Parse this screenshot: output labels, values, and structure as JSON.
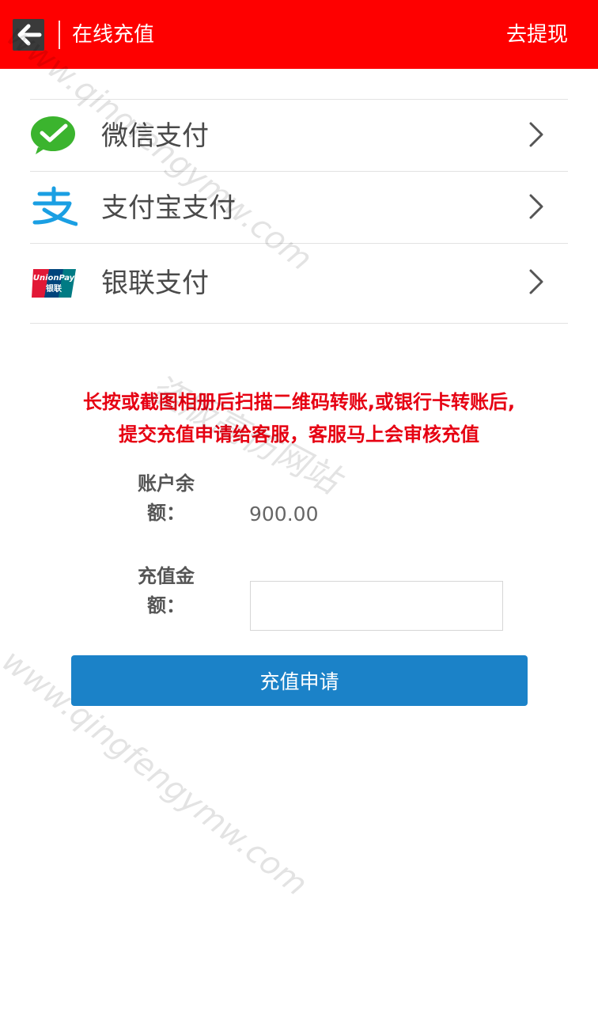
{
  "header": {
    "title": "在线充值",
    "action_label": "去提现",
    "background": "#fe0000",
    "back_icon": "arrow-left-icon"
  },
  "payment_methods": [
    {
      "label": "微信支付",
      "icon": "wechat-pay-icon",
      "chevron": "chevron-right-icon"
    },
    {
      "label": "支付宝支付",
      "icon": "alipay-icon",
      "chevron": "chevron-right-icon"
    },
    {
      "label": "银联支付",
      "icon": "unionpay-icon",
      "icon_text": "UnionPay",
      "icon_subtext": "银联",
      "chevron": "chevron-right-icon"
    }
  ],
  "notice": {
    "line1": "长按或截图相册后扫描二维码转账,或银行卡转账后,",
    "line2": "提交充值申请给客服，客服马上会审核充值",
    "color": "#e60012"
  },
  "balance": {
    "label_line1": "账户余",
    "label_line2": "额：",
    "value": "900.00"
  },
  "amount": {
    "label_line1": "充值金",
    "label_line2": "额：",
    "value": ""
  },
  "submit_label": "充值申请",
  "accent": "#1b82c8",
  "watermarks": {
    "url": "www.qingfengymw.com",
    "cn_text": "盗版高仿网站"
  }
}
